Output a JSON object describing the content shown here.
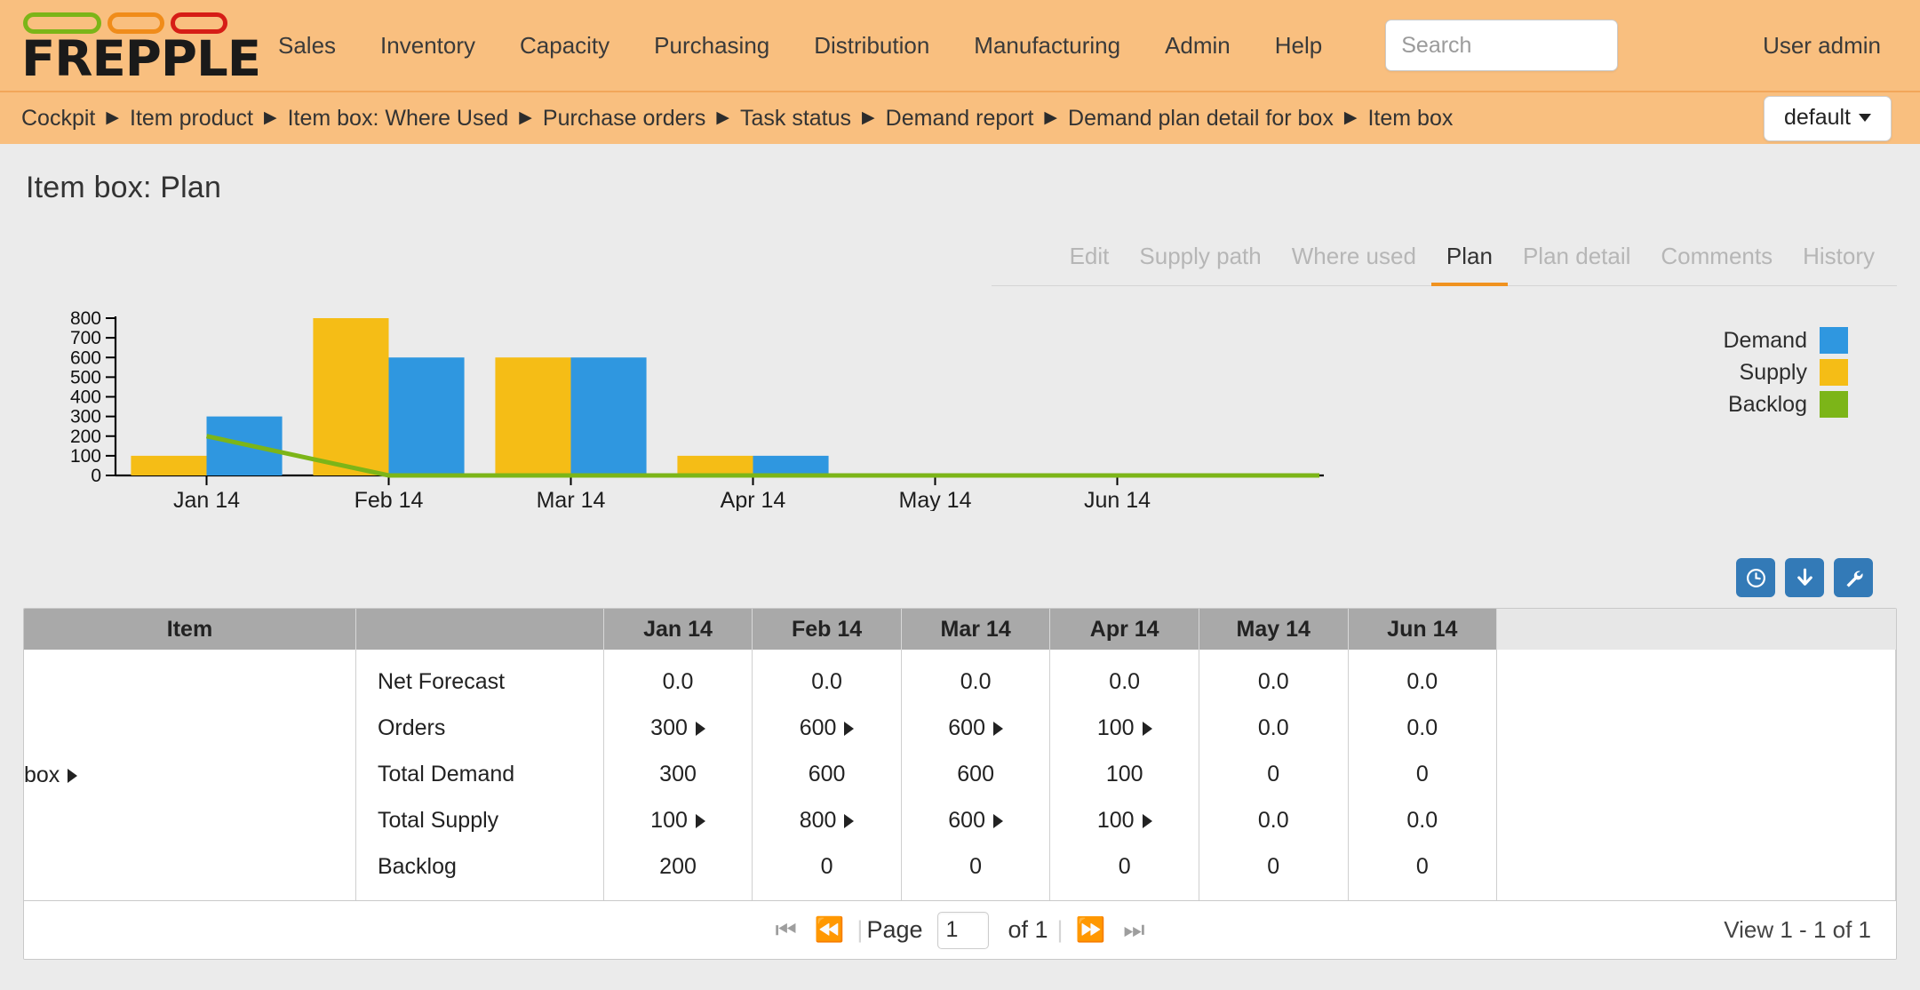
{
  "brand": {
    "name": "FREPPLE",
    "pill_colors": [
      "#7cb518",
      "#f08c1a",
      "#d61d16"
    ]
  },
  "nav": {
    "items": [
      "Sales",
      "Inventory",
      "Capacity",
      "Purchasing",
      "Distribution",
      "Manufacturing",
      "Admin",
      "Help"
    ],
    "search_placeholder": "Search",
    "search_value": "",
    "user": "User admin"
  },
  "breadcrumb": {
    "items": [
      "Cockpit",
      "Item product",
      "Item box: Where Used",
      "Purchase orders",
      "Task status",
      "Demand report",
      "Demand plan detail for box",
      "Item box"
    ],
    "separator": "▶",
    "scenario": "default"
  },
  "page": {
    "title": "Item box: Plan"
  },
  "tabs": {
    "items": [
      {
        "label": "Edit",
        "active": false
      },
      {
        "label": "Supply path",
        "active": false
      },
      {
        "label": "Where used",
        "active": false
      },
      {
        "label": "Plan",
        "active": true
      },
      {
        "label": "Plan detail",
        "active": false
      },
      {
        "label": "Comments",
        "active": false
      },
      {
        "label": "History",
        "active": false
      }
    ]
  },
  "colors": {
    "demand": "#2f97e0",
    "supply": "#f5bd16",
    "backlog": "#7cb518",
    "header_bg": "#f9bf7f",
    "accent": "#f0921f",
    "button_blue": "#337ab7"
  },
  "chart_data": {
    "type": "bar",
    "title": "",
    "xlabel": "",
    "ylabel": "",
    "categories": [
      "Jan 14",
      "Feb 14",
      "Mar 14",
      "Apr 14",
      "May 14",
      "Jun 14"
    ],
    "ylim": [
      0,
      800
    ],
    "yticks": [
      0,
      100,
      200,
      300,
      400,
      500,
      600,
      700,
      800
    ],
    "grid": false,
    "legend_position": "right",
    "series": [
      {
        "name": "Supply",
        "type": "bar",
        "color": "#f5bd16",
        "values": [
          100,
          800,
          600,
          100,
          0,
          0
        ]
      },
      {
        "name": "Demand",
        "type": "bar",
        "color": "#2f97e0",
        "values": [
          300,
          600,
          600,
          100,
          0,
          0
        ]
      },
      {
        "name": "Backlog",
        "type": "line",
        "color": "#7cb518",
        "values": [
          200,
          0,
          0,
          0,
          0,
          0
        ]
      }
    ]
  },
  "legend": [
    {
      "label": "Demand",
      "color": "#2f97e0"
    },
    {
      "label": "Supply",
      "color": "#f5bd16"
    },
    {
      "label": "Backlog",
      "color": "#7cb518"
    }
  ],
  "toolbar": [
    {
      "name": "history-button",
      "icon": "clock-icon"
    },
    {
      "name": "download-button",
      "icon": "download-arrow-icon"
    },
    {
      "name": "settings-button",
      "icon": "wrench-icon"
    }
  ],
  "table": {
    "headers": [
      "Item",
      "",
      "Jan 14",
      "Feb 14",
      "Mar 14",
      "Apr 14",
      "May 14",
      "Jun 14",
      ""
    ],
    "row_item": "box",
    "metric_labels": [
      "Net Forecast",
      "Orders",
      "Total Demand",
      "Total Supply",
      "Backlog"
    ],
    "cells": [
      {
        "values": [
          "0.0",
          "300",
          "300",
          "100",
          "200"
        ],
        "drill": [
          false,
          true,
          false,
          true,
          false
        ]
      },
      {
        "values": [
          "0.0",
          "600",
          "600",
          "800",
          "0"
        ],
        "drill": [
          false,
          true,
          false,
          true,
          false
        ]
      },
      {
        "values": [
          "0.0",
          "600",
          "600",
          "600",
          "0"
        ],
        "drill": [
          false,
          true,
          false,
          true,
          false
        ]
      },
      {
        "values": [
          "0.0",
          "100",
          "100",
          "100",
          "0"
        ],
        "drill": [
          false,
          true,
          false,
          true,
          false
        ]
      },
      {
        "values": [
          "0.0",
          "0.0",
          "0",
          "0.0",
          "0"
        ],
        "drill": [
          false,
          false,
          false,
          false,
          false
        ]
      },
      {
        "values": [
          "0.0",
          "0.0",
          "0",
          "0.0",
          "0"
        ],
        "drill": [
          false,
          false,
          false,
          false,
          false
        ]
      }
    ]
  },
  "pager": {
    "first": "⏮",
    "prev": "⏪",
    "page_label": "Page",
    "page_value": "1",
    "of_label": "of 1",
    "next": "⏩",
    "last": "⏭",
    "view_count": "View 1 - 1 of 1"
  }
}
